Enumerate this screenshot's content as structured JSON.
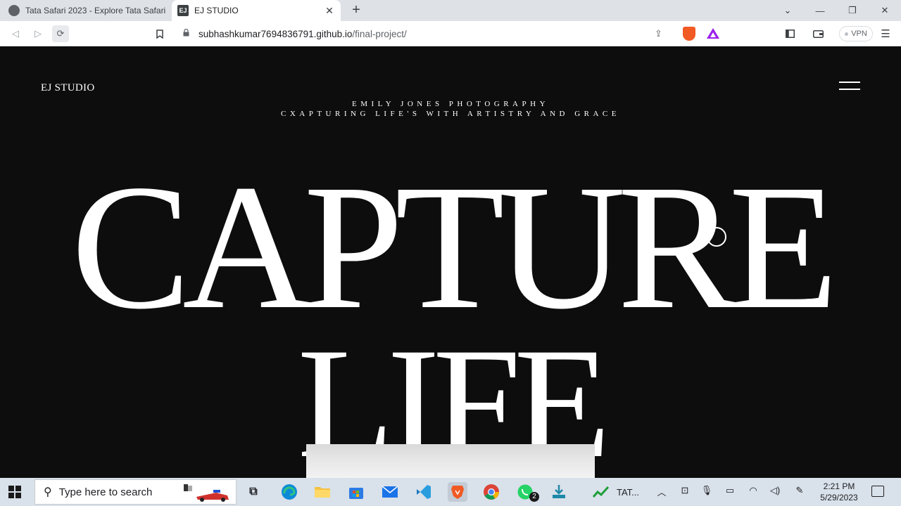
{
  "browser": {
    "tabs": [
      {
        "title": "Tata Safari 2023 - Explore Tata Safari",
        "active": false
      },
      {
        "title": "EJ STUDIO",
        "favicon_text": "EJ",
        "active": true
      }
    ],
    "new_tab_label": "+",
    "address": {
      "host": "subhashkumar7694836791.github.io",
      "path": "/final-project/"
    },
    "vpn_label": "VPN",
    "icons": {
      "back": "back-arrow-icon",
      "forward": "forward-arrow-icon",
      "reload": "reload-icon",
      "bookmark": "bookmark-icon",
      "lock": "lock-icon",
      "share": "share-icon",
      "brave_shields": "brave-lion-icon",
      "brave_rewards": "brave-rewards-triangle-icon",
      "sidebar": "sidebar-icon",
      "wallet": "wallet-icon",
      "menu": "hamburger-menu-icon"
    },
    "colors": {
      "brave_orange": "#f15a24",
      "rewards_purple": "#9b1fe8"
    }
  },
  "site": {
    "logo": "EJ STUDIO",
    "tagline_1": "EMILY JONES PHOTOGRAPHY",
    "tagline_2": "CXAPTURING LIFE'S WITH ARTISTRY AND GRACE",
    "hero_line_1": "CAPTURE",
    "hero_line_2": "LIFE",
    "colors": {
      "background": "#0d0d0d",
      "text": "#ffffff"
    }
  },
  "taskbar": {
    "search_placeholder": "Type here to search",
    "pinned": [
      {
        "name": "task-view-icon"
      },
      {
        "name": "edge-icon"
      },
      {
        "name": "file-explorer-icon"
      },
      {
        "name": "microsoft-store-icon"
      },
      {
        "name": "mail-icon"
      },
      {
        "name": "vscode-icon"
      },
      {
        "name": "brave-icon"
      },
      {
        "name": "chrome-icon"
      },
      {
        "name": "whatsapp-icon"
      },
      {
        "name": "installer-icon"
      }
    ],
    "whatsapp_badge": "2",
    "running_app_label": "TAT...",
    "time": "2:21 PM",
    "date": "5/29/2023"
  }
}
